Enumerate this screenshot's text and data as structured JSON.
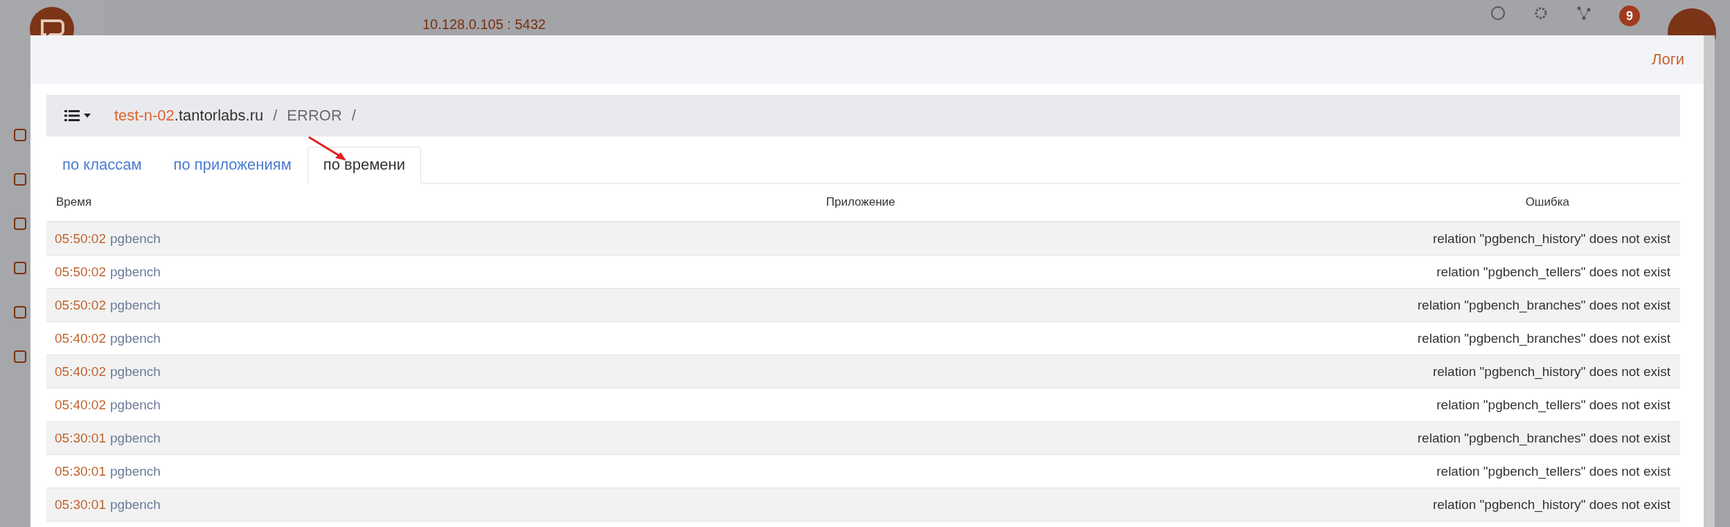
{
  "background": {
    "host_address": "10.128.0.105 : 5432",
    "notification_count": "9"
  },
  "modal": {
    "title": "Логи",
    "breadcrumb": {
      "host": "test-n-02",
      "domain": ".tantorlabs.ru",
      "separator_1": "/",
      "level": "ERROR",
      "separator_2": "/"
    },
    "tabs": [
      {
        "label": "по классам",
        "selected": false
      },
      {
        "label": "по приложениям",
        "selected": false
      },
      {
        "label": "по времени",
        "selected": true
      }
    ],
    "table": {
      "columns": [
        "Время",
        "Приложение",
        "Ошибка"
      ],
      "rows": [
        {
          "time": "05:50:02",
          "application": "pgbench",
          "error": "relation \"pgbench_history\" does not exist"
        },
        {
          "time": "05:50:02",
          "application": "pgbench",
          "error": "relation \"pgbench_tellers\" does not exist"
        },
        {
          "time": "05:50:02",
          "application": "pgbench",
          "error": "relation \"pgbench_branches\" does not exist"
        },
        {
          "time": "05:40:02",
          "application": "pgbench",
          "error": "relation \"pgbench_branches\" does not exist"
        },
        {
          "time": "05:40:02",
          "application": "pgbench",
          "error": "relation \"pgbench_history\" does not exist"
        },
        {
          "time": "05:40:02",
          "application": "pgbench",
          "error": "relation \"pgbench_tellers\" does not exist"
        },
        {
          "time": "05:30:01",
          "application": "pgbench",
          "error": "relation \"pgbench_branches\" does not exist"
        },
        {
          "time": "05:30:01",
          "application": "pgbench",
          "error": "relation \"pgbench_tellers\" does not exist"
        },
        {
          "time": "05:30:01",
          "application": "pgbench",
          "error": "relation \"pgbench_history\" does not exist"
        }
      ]
    }
  }
}
